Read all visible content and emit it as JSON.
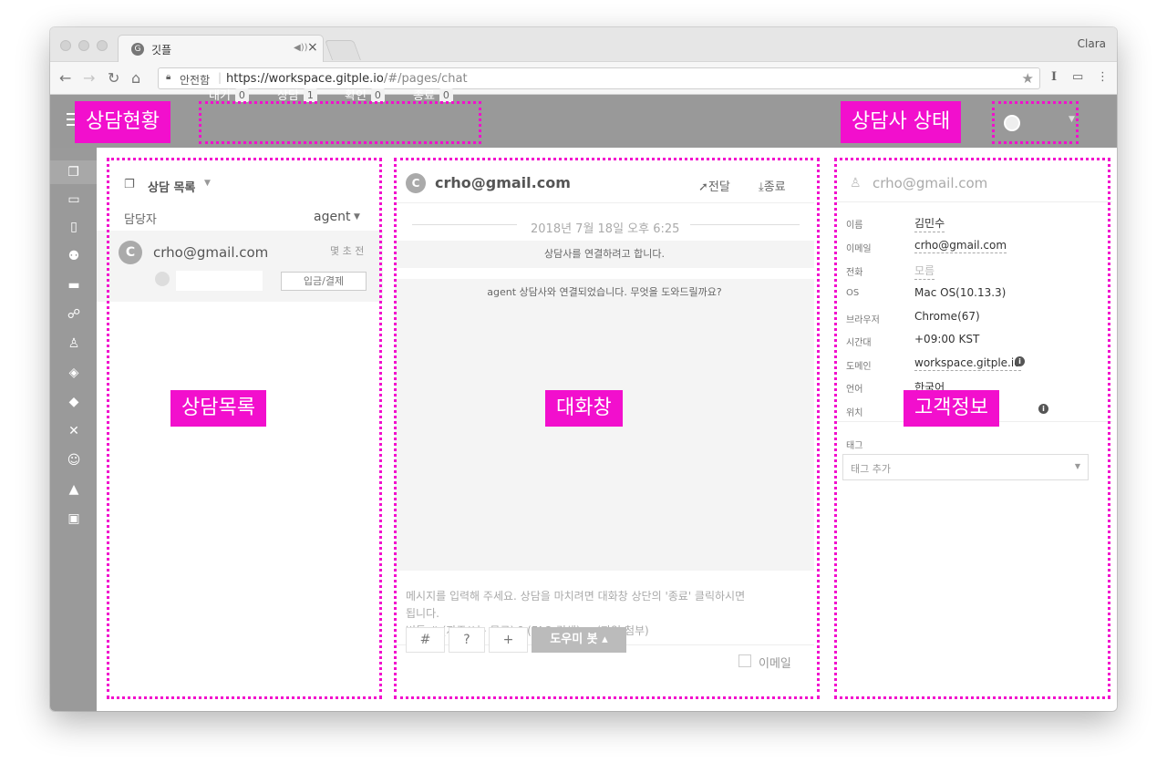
{
  "browser": {
    "tab_title": "깃플",
    "tab_favicon": "G",
    "user": "Clara",
    "secure_label": "안전함",
    "url_host": "https://workspace.gitple.io",
    "url_path": "/#/pages/chat"
  },
  "annotations": {
    "status_label": "상담현황",
    "agent_status_label": "상담사 상태",
    "list_label": "상담목록",
    "chat_label": "대화창",
    "customer_label": "고객정보",
    "accent_color": "#f20fcd"
  },
  "status_tabs": [
    {
      "label": "대기",
      "count": "0"
    },
    {
      "label": "상담",
      "count": "1"
    },
    {
      "label": "확인",
      "count": "0"
    },
    {
      "label": "종료",
      "count": "0"
    }
  ],
  "chat_list": {
    "title": "상담 목록",
    "assignee_label": "담당자",
    "assignee_value": "agent",
    "items": [
      {
        "avatar": "C",
        "email": "crho@gmail.com",
        "time": "몇 초 전",
        "action": "입금/결제"
      }
    ]
  },
  "chat": {
    "avatar": "C",
    "title": "crho@gmail.com",
    "forward_label": "전달",
    "end_label": "종료",
    "date": "2018년 7월 18일 오후 6:25",
    "system_messages": [
      "상담사를 연결하려고 합니다.",
      "agent 상담사와 연결되었습니다. 무엇을 도와드릴까요?"
    ],
    "input_placeholder_lines": [
      "메시지를 입력해 주세요. 상담을 마치려면 대화창 상단의 '종료' 클릭하시면",
      "됩니다.",
      "버튼 # (자주쓰는 문구) ? (FAQ 검색) + (파일 첨부)"
    ],
    "buttons": [
      "#",
      "?",
      "+"
    ],
    "bot_button": "도우미 봇",
    "email_checkbox_label": "이메일"
  },
  "customer": {
    "title": "crho@gmail.com",
    "fields": [
      {
        "label": "이름",
        "value": "김민수"
      },
      {
        "label": "이메일",
        "value": "crho@gmail.com"
      },
      {
        "label": "전화",
        "value": "모름"
      },
      {
        "label": "OS",
        "value": "Mac OS(10.13.3)"
      },
      {
        "label": "브라우저",
        "value": "Chrome(67)"
      },
      {
        "label": "시간대",
        "value": "+09:00 KST"
      },
      {
        "label": "도메인",
        "value": "workspace.gitple.io"
      },
      {
        "label": "언어",
        "value": "한국어"
      },
      {
        "label": "위치",
        "value": ""
      }
    ],
    "tag_label": "태그",
    "tag_placeholder": "태그 추가"
  },
  "sidebar_icons": [
    "chat-icon",
    "monitor-icon",
    "clipboard-icon",
    "users-icon",
    "briefcase-icon",
    "sitemap-icon",
    "android-icon",
    "graduation-cap-icon",
    "tags-icon",
    "tools-icon",
    "smile-icon",
    "flask-icon",
    "comment-smile-icon"
  ]
}
